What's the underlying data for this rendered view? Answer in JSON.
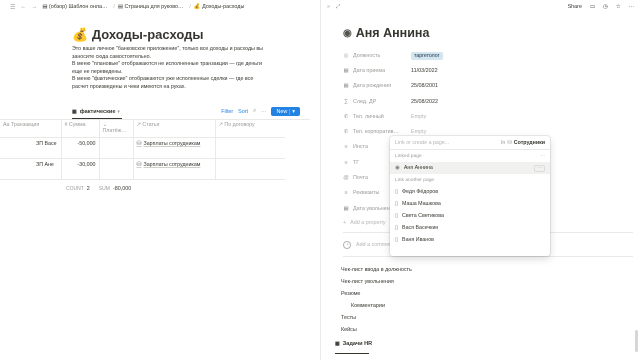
{
  "left": {
    "breadcrumbs": [
      "(обзор) Шаблон онла…",
      "Страница для руково…",
      "Доходы-расходы"
    ],
    "title": "Доходы-расходы",
    "description": [
      "Это ваше личное \"банковское приложение\", только все доходы и расходы вы",
      "заносите сюда самостоятельно.",
      "В меню \"плановые\" отображаются не исполненные транзакции — где деньги",
      "еще не переведены.",
      "В меню \"фактические\" отображаются уже исполненные сделки — где все",
      "расчет произведены и чеки имеются на руках."
    ],
    "view": {
      "tab_label": "фактические",
      "filter": "Filter",
      "sort": "Sort",
      "new_label": "New"
    },
    "table": {
      "headers": [
        "Транзакция",
        "Сумма",
        "Платёж…",
        "Статья",
        "По договору"
      ],
      "rows": [
        {
          "transaction": "ЗП Васе",
          "amount": "-50,000",
          "payment": "",
          "article": "Зарплаты сотрудникам",
          "contract": ""
        },
        {
          "transaction": "ЗП Ане",
          "amount": "-30,000",
          "payment": "",
          "article": "Зарплаты сотрудникам",
          "contract": ""
        }
      ]
    },
    "footer": {
      "count_label": "COUNT",
      "count_value": "2",
      "sum_label": "SUM",
      "sum_value": "-80,000"
    }
  },
  "right": {
    "share": "Share",
    "title": "Аня Аннина",
    "properties": [
      {
        "icon": "◎",
        "label": "Должность",
        "value": "таргетолог",
        "type": "badge"
      },
      {
        "icon": "▦",
        "label": "Дата приема",
        "value": "11/03/2022",
        "type": "text"
      },
      {
        "icon": "▦",
        "label": "Дата рождения",
        "value": "25/08/2001",
        "type": "text"
      },
      {
        "icon": "∑",
        "label": "След. ДР",
        "value": "25/08/2022",
        "type": "text"
      },
      {
        "icon": "✆",
        "label": "Тел. личный",
        "value": "Empty",
        "type": "empty"
      },
      {
        "icon": "✆",
        "label": "Тел. корпоратив…",
        "value": "Empty",
        "type": "empty"
      },
      {
        "icon": "≡",
        "label": "Инста",
        "value": "",
        "type": "empty"
      },
      {
        "icon": "≡",
        "label": "ТГ",
        "value": "",
        "type": "empty"
      },
      {
        "icon": "@",
        "label": "Почта",
        "value": "",
        "type": "empty"
      },
      {
        "icon": "≡",
        "label": "Реквизиты",
        "value": "",
        "type": "empty"
      },
      {
        "icon": "▦",
        "label": "Дата увольнен…",
        "value": "",
        "type": "empty"
      }
    ],
    "add_property": "Add a property",
    "add_comment": "Add a comment…",
    "blocks": [
      "Чек-лист ввода в должность",
      "Чек-лист увольнения",
      "Резюме",
      "Комментарии",
      "Тесты",
      "Кейсы"
    ],
    "bottom_tab": "Задачи HR"
  },
  "popup": {
    "placeholder": "Link or create a page...",
    "in_label": "In",
    "db_name": "Сотрудники",
    "linked_label": "Linked page",
    "linked_item": "Аня Аннина",
    "another_label": "Link another page",
    "items": [
      "Федя Фёдоров",
      "Маша Машкова",
      "Света Светикова",
      "Вася Васечкин",
      "Ваня Иванов"
    ]
  }
}
